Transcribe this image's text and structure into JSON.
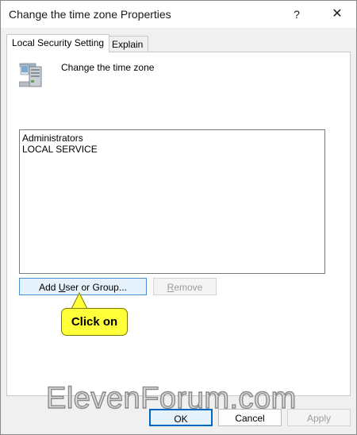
{
  "window": {
    "title": "Change the time zone Properties",
    "help_label": "?",
    "close_label": "✕"
  },
  "tabs": [
    {
      "label": "Local Security Setting",
      "active": true
    },
    {
      "label": "Explain",
      "active": false
    }
  ],
  "policy": {
    "name": "Change the time zone",
    "icon": "server-computer-icon"
  },
  "members": [
    "Administrators",
    "LOCAL SERVICE"
  ],
  "buttons": {
    "add_prefix": "Add ",
    "add_mnemonic": "U",
    "add_suffix": "ser or Group...",
    "remove_mnemonic": "R",
    "remove_suffix": "emove",
    "ok": "OK",
    "cancel": "Cancel",
    "apply": "Apply"
  },
  "callout": {
    "text": "Click on",
    "color": "#ffff3a"
  },
  "watermark": "ElevenForum.com",
  "colors": {
    "accent": "#0067c0",
    "disabled_text": "#9c9c9c"
  }
}
